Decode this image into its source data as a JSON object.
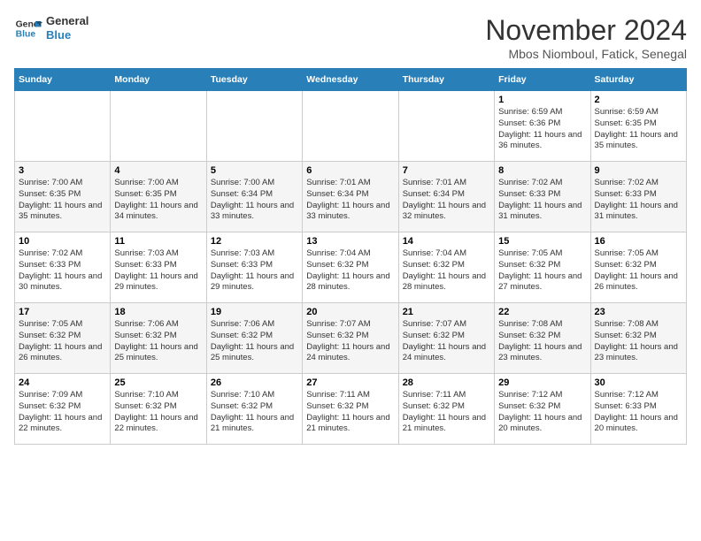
{
  "header": {
    "logo_line1": "General",
    "logo_line2": "Blue",
    "title": "November 2024",
    "subtitle": "Mbos Niomboul, Fatick, Senegal"
  },
  "days_of_week": [
    "Sunday",
    "Monday",
    "Tuesday",
    "Wednesday",
    "Thursday",
    "Friday",
    "Saturday"
  ],
  "weeks": [
    [
      {
        "day": "",
        "info": ""
      },
      {
        "day": "",
        "info": ""
      },
      {
        "day": "",
        "info": ""
      },
      {
        "day": "",
        "info": ""
      },
      {
        "day": "",
        "info": ""
      },
      {
        "day": "1",
        "info": "Sunrise: 6:59 AM\nSunset: 6:36 PM\nDaylight: 11 hours and 36 minutes."
      },
      {
        "day": "2",
        "info": "Sunrise: 6:59 AM\nSunset: 6:35 PM\nDaylight: 11 hours and 35 minutes."
      }
    ],
    [
      {
        "day": "3",
        "info": "Sunrise: 7:00 AM\nSunset: 6:35 PM\nDaylight: 11 hours and 35 minutes."
      },
      {
        "day": "4",
        "info": "Sunrise: 7:00 AM\nSunset: 6:35 PM\nDaylight: 11 hours and 34 minutes."
      },
      {
        "day": "5",
        "info": "Sunrise: 7:00 AM\nSunset: 6:34 PM\nDaylight: 11 hours and 33 minutes."
      },
      {
        "day": "6",
        "info": "Sunrise: 7:01 AM\nSunset: 6:34 PM\nDaylight: 11 hours and 33 minutes."
      },
      {
        "day": "7",
        "info": "Sunrise: 7:01 AM\nSunset: 6:34 PM\nDaylight: 11 hours and 32 minutes."
      },
      {
        "day": "8",
        "info": "Sunrise: 7:02 AM\nSunset: 6:33 PM\nDaylight: 11 hours and 31 minutes."
      },
      {
        "day": "9",
        "info": "Sunrise: 7:02 AM\nSunset: 6:33 PM\nDaylight: 11 hours and 31 minutes."
      }
    ],
    [
      {
        "day": "10",
        "info": "Sunrise: 7:02 AM\nSunset: 6:33 PM\nDaylight: 11 hours and 30 minutes."
      },
      {
        "day": "11",
        "info": "Sunrise: 7:03 AM\nSunset: 6:33 PM\nDaylight: 11 hours and 29 minutes."
      },
      {
        "day": "12",
        "info": "Sunrise: 7:03 AM\nSunset: 6:33 PM\nDaylight: 11 hours and 29 minutes."
      },
      {
        "day": "13",
        "info": "Sunrise: 7:04 AM\nSunset: 6:32 PM\nDaylight: 11 hours and 28 minutes."
      },
      {
        "day": "14",
        "info": "Sunrise: 7:04 AM\nSunset: 6:32 PM\nDaylight: 11 hours and 28 minutes."
      },
      {
        "day": "15",
        "info": "Sunrise: 7:05 AM\nSunset: 6:32 PM\nDaylight: 11 hours and 27 minutes."
      },
      {
        "day": "16",
        "info": "Sunrise: 7:05 AM\nSunset: 6:32 PM\nDaylight: 11 hours and 26 minutes."
      }
    ],
    [
      {
        "day": "17",
        "info": "Sunrise: 7:05 AM\nSunset: 6:32 PM\nDaylight: 11 hours and 26 minutes."
      },
      {
        "day": "18",
        "info": "Sunrise: 7:06 AM\nSunset: 6:32 PM\nDaylight: 11 hours and 25 minutes."
      },
      {
        "day": "19",
        "info": "Sunrise: 7:06 AM\nSunset: 6:32 PM\nDaylight: 11 hours and 25 minutes."
      },
      {
        "day": "20",
        "info": "Sunrise: 7:07 AM\nSunset: 6:32 PM\nDaylight: 11 hours and 24 minutes."
      },
      {
        "day": "21",
        "info": "Sunrise: 7:07 AM\nSunset: 6:32 PM\nDaylight: 11 hours and 24 minutes."
      },
      {
        "day": "22",
        "info": "Sunrise: 7:08 AM\nSunset: 6:32 PM\nDaylight: 11 hours and 23 minutes."
      },
      {
        "day": "23",
        "info": "Sunrise: 7:08 AM\nSunset: 6:32 PM\nDaylight: 11 hours and 23 minutes."
      }
    ],
    [
      {
        "day": "24",
        "info": "Sunrise: 7:09 AM\nSunset: 6:32 PM\nDaylight: 11 hours and 22 minutes."
      },
      {
        "day": "25",
        "info": "Sunrise: 7:10 AM\nSunset: 6:32 PM\nDaylight: 11 hours and 22 minutes."
      },
      {
        "day": "26",
        "info": "Sunrise: 7:10 AM\nSunset: 6:32 PM\nDaylight: 11 hours and 21 minutes."
      },
      {
        "day": "27",
        "info": "Sunrise: 7:11 AM\nSunset: 6:32 PM\nDaylight: 11 hours and 21 minutes."
      },
      {
        "day": "28",
        "info": "Sunrise: 7:11 AM\nSunset: 6:32 PM\nDaylight: 11 hours and 21 minutes."
      },
      {
        "day": "29",
        "info": "Sunrise: 7:12 AM\nSunset: 6:32 PM\nDaylight: 11 hours and 20 minutes."
      },
      {
        "day": "30",
        "info": "Sunrise: 7:12 AM\nSunset: 6:33 PM\nDaylight: 11 hours and 20 minutes."
      }
    ]
  ]
}
